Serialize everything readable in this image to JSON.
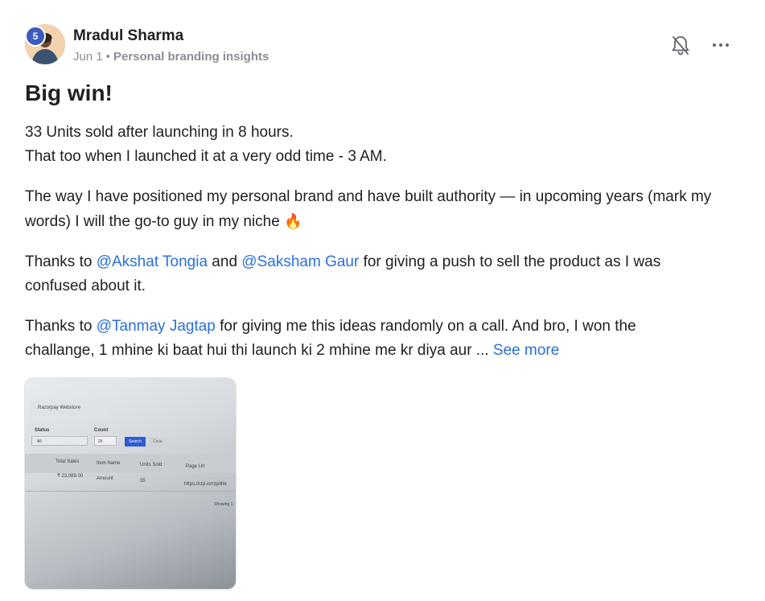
{
  "post": {
    "author": {
      "name": "Mradul Sharma",
      "level": "5"
    },
    "date": "Jun 1",
    "separator": "•",
    "category": "Personal branding insights",
    "actions": {
      "bell_icon": "bell-off-icon",
      "more_icon": "more-horizontal-icon"
    },
    "title": "Big win!",
    "paragraphs": {
      "p1_line1": "33 Units sold after launching in 8 hours.",
      "p1_line2": "That too when I launched it at a very odd time - 3 AM.",
      "p2_line1": "The way I have positioned my personal brand and have built authority — in upcoming years (mark my",
      "p2_line2": "words) I will the go-to guy in my niche",
      "p2_emoji": "🔥",
      "p3_prefix": "Thanks to ",
      "p3_mention1": "@Akshat Tongia",
      "p3_and": " and ",
      "p3_mention2": "@Saksham Gaur",
      "p3_suffix": " for giving a push to sell the product as I was",
      "p3_line2": "confused about it.",
      "p4_prefix": "Thanks to ",
      "p4_mention": "@Tanmay Jagtap",
      "p4_suffix": " for giving me this ideas randomly on a call. And bro, I won the",
      "p4_line2": "challange, 1 mhine ki baat hui thi launch ki 2 mhine me kr diya aur ... ",
      "see_more": "See more"
    },
    "attachment": {
      "store_label": "Razorpay Webstore",
      "status_label": "Status",
      "status_value": "All",
      "count_label": "Count",
      "count_value": "25",
      "search_button": "Search",
      "clear_button": "Clear",
      "columns": [
        "Total Sales",
        "Item Name",
        "Units Sold",
        "Page Url"
      ],
      "row": [
        "₹ 23,089.00",
        "Amount",
        "35",
        "https://rzp.io/rzp/the"
      ],
      "footer": "Showing 1"
    }
  },
  "colors": {
    "accent_link": "#2a6fdb",
    "level_badge": "#3d5bbf",
    "meta_text": "#8a8f96"
  }
}
